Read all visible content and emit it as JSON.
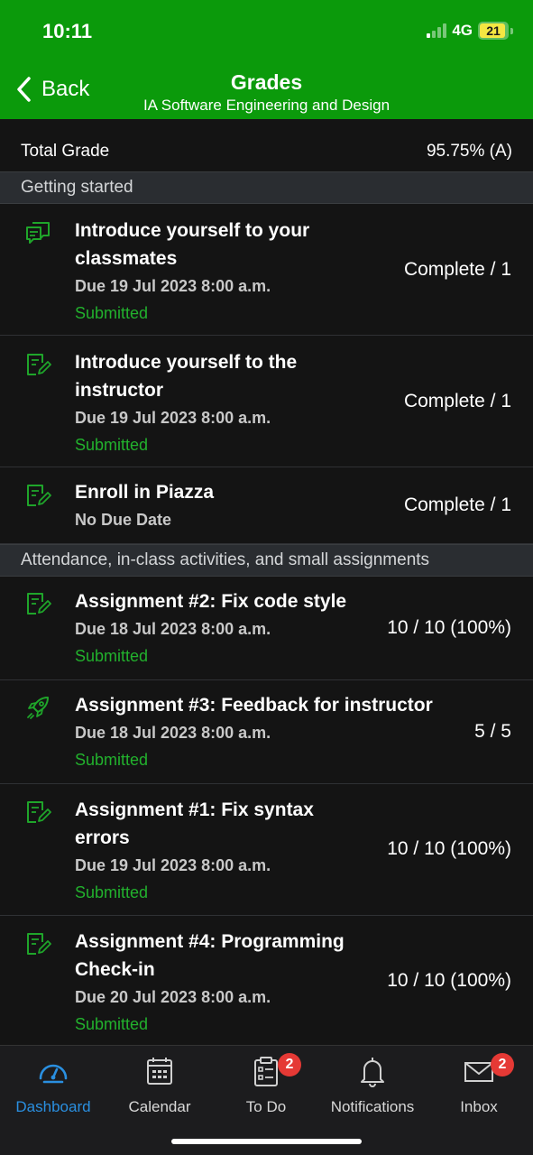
{
  "status_bar": {
    "time": "10:11",
    "network": "4G",
    "battery": "21",
    "battery_level": 0.21,
    "signal_bars_on": 1,
    "signal_bars_total": 4
  },
  "header": {
    "back_label": "Back",
    "title": "Grades",
    "subtitle": "IA Software Engineering and Design"
  },
  "total": {
    "label": "Total Grade",
    "value": "95.75% (A)"
  },
  "sections": [
    {
      "title": "Getting started"
    },
    {
      "title": "Attendance, in-class activities, and small assignments"
    }
  ],
  "items": [
    {
      "icon": "discussion-icon",
      "title_line1": "Introduce yourself to your",
      "title_line2": "classmates",
      "due": "Due 19 Jul 2023 8:00 a.m.",
      "status": "Submitted",
      "score": "Complete / 1"
    },
    {
      "icon": "assignment-icon",
      "title_line1": "Introduce yourself to the",
      "title_line2": "instructor",
      "due": "Due 19 Jul 2023 8:00 a.m.",
      "status": "Submitted",
      "score": "Complete / 1"
    },
    {
      "icon": "assignment-icon",
      "title_line1": "Enroll in Piazza",
      "due": "No Due Date",
      "score": "Complete / 1"
    },
    {
      "icon": "assignment-icon",
      "title_line1": "Assignment #2: Fix code style",
      "due": "Due 18 Jul 2023 8:00 a.m.",
      "status": "Submitted",
      "score": "10 / 10 (100%)"
    },
    {
      "icon": "rocket-icon",
      "title_line1": "Assignment #3: Feedback for instructor",
      "due": "Due 18 Jul 2023 8:00 a.m.",
      "status": "Submitted",
      "score": "5 / 5"
    },
    {
      "icon": "assignment-icon",
      "title_line1": "Assignment #1: Fix syntax",
      "title_line2": "errors",
      "due": "Due 19 Jul 2023 8:00 a.m.",
      "status": "Submitted",
      "score": "10 / 10 (100%)"
    },
    {
      "icon": "assignment-icon",
      "title_line1": "Assignment #4: Programming",
      "title_line2": "Check-in",
      "due": "Due 20 Jul 2023 8:00 a.m.",
      "status": "Submitted",
      "score": "10 / 10 (100%)"
    }
  ],
  "tabbar": {
    "tabs": [
      {
        "label": "Dashboard",
        "icon": "dashboard-gauge-icon",
        "active": true
      },
      {
        "label": "Calendar",
        "icon": "calendar-icon"
      },
      {
        "label": "To Do",
        "icon": "clipboard-icon",
        "badge": "2"
      },
      {
        "label": "Notifications",
        "icon": "bell-icon"
      },
      {
        "label": "Inbox",
        "icon": "envelope-icon",
        "badge": "2"
      }
    ]
  },
  "colors": {
    "header_green": "#0b9a0b",
    "submitted_green": "#22b12d",
    "active_tab_blue": "#2a8fe0",
    "badge_red": "#e53935",
    "icon_green": "#1fa52a"
  }
}
